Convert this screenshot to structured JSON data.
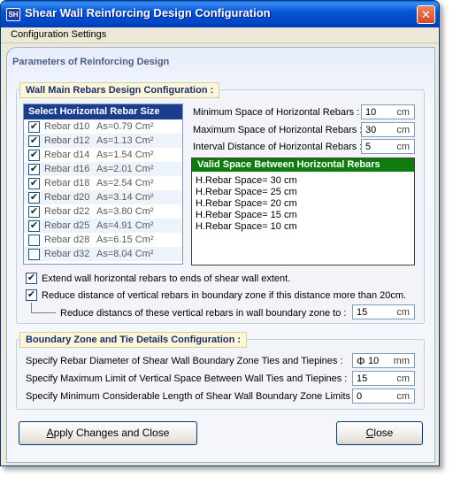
{
  "window": {
    "title": "Shear Wall Reinforcing Design Configuration",
    "app_icon_text": "SH",
    "close_glyph": "✕"
  },
  "menu": {
    "items": [
      "Configuration Settings"
    ]
  },
  "panel": {
    "title": "Parameters of Reinforcing Design"
  },
  "main_rebars": {
    "caption": "Wall Main Rebars Design Configuration :",
    "list_header": "Select Horizontal Rebar Size",
    "rebars": [
      {
        "name": "Rebar d10",
        "area": "As=0.79  Cm²",
        "checked": true
      },
      {
        "name": "Rebar d12",
        "area": "As=1.13  Cm²",
        "checked": true
      },
      {
        "name": "Rebar d14",
        "area": "As=1.54  Cm²",
        "checked": true
      },
      {
        "name": "Rebar d16",
        "area": "As=2.01  Cm²",
        "checked": true
      },
      {
        "name": "Rebar d18",
        "area": "As=2.54  Cm²",
        "checked": true
      },
      {
        "name": "Rebar d20",
        "area": "As=3.14  Cm²",
        "checked": true
      },
      {
        "name": "Rebar d22",
        "area": "As=3.80  Cm²",
        "checked": true
      },
      {
        "name": "Rebar d25",
        "area": "As=4.91  Cm²",
        "checked": true
      },
      {
        "name": "Rebar d28",
        "area": "As=6.15  Cm²",
        "checked": false
      },
      {
        "name": "Rebar d32",
        "area": "As=8.04  Cm²",
        "checked": false
      }
    ],
    "min_space": {
      "label": "Minimum  Space of  Horizontal Rebars :",
      "value": "10",
      "unit": "cm"
    },
    "max_space": {
      "label": "Maximum Space of  Horizontal Rebars :",
      "value": "30",
      "unit": "cm"
    },
    "interval": {
      "label": "Interval Distance of Horizontal Rebars :",
      "value": "5",
      "unit": "cm"
    },
    "valid_header": "Valid Space Between Horizontal Rebars",
    "valid_spaces": [
      "H.Rebar Space= 30 cm",
      "H.Rebar Space= 25 cm",
      "H.Rebar Space= 20 cm",
      "H.Rebar Space= 15 cm",
      "H.Rebar Space= 10 cm"
    ],
    "extend_option": {
      "label": "Extend wall horizontal rebars to ends of shear wall extent.",
      "checked": true
    },
    "reduce_option": {
      "label": "Reduce distance of vertical rebars in boundary zone if this distance more than 20cm.",
      "checked": true
    },
    "reduce_distance": {
      "label": "Reduce distancs of these vertical rebars in wall boundary zone to :",
      "value": "15",
      "unit": "cm"
    }
  },
  "boundary": {
    "caption": "Boundary Zone and Tie Details Configuration :",
    "tie_diameter": {
      "label": "Specify Rebar Diameter of Shear Wall Boundary  Zone Ties  and  Tiepines :",
      "symbol": "Φ",
      "value": "10",
      "unit": "mm"
    },
    "max_tie_space": {
      "label": "Specify Maximum Limit of Vertical Space Between Wall Ties  and  Tiepines :",
      "value": "15",
      "unit": "cm"
    },
    "min_length": {
      "label": "Specify Minimum Considerable Length of Shear Wall Boundary Zone Limits :",
      "value": "0",
      "unit": "cm"
    }
  },
  "buttons": {
    "apply_prefix": "A",
    "apply_rest": "pply Changes and Close",
    "close_prefix": "C",
    "close_rest": "lose"
  }
}
